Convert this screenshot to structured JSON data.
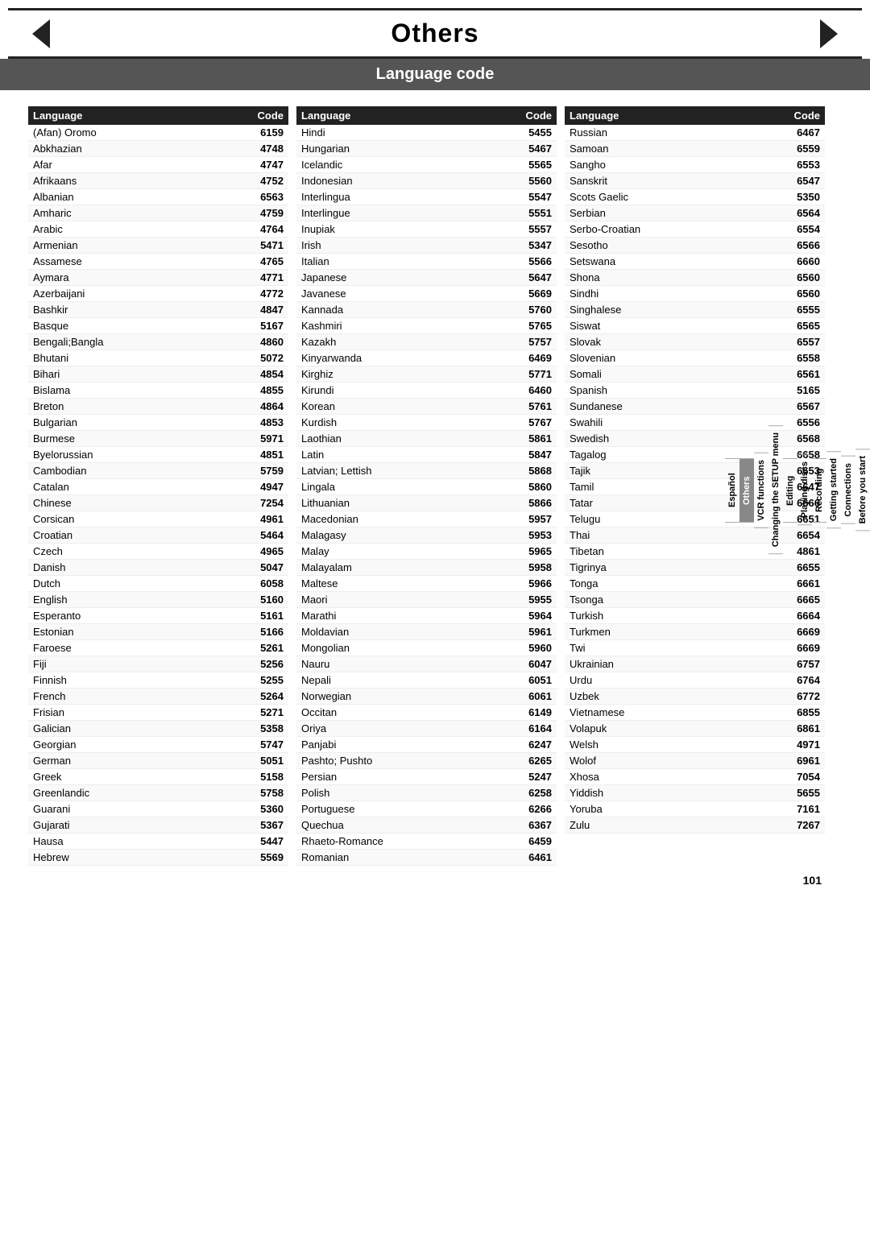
{
  "header": {
    "title": "Others",
    "subtitle": "Language code"
  },
  "columns": [
    {
      "header_lang": "Language",
      "header_code": "Code",
      "rows": [
        {
          "lang": "(Afan) Oromo",
          "code": "6159"
        },
        {
          "lang": "Abkhazian",
          "code": "4748"
        },
        {
          "lang": "Afar",
          "code": "4747"
        },
        {
          "lang": "Afrikaans",
          "code": "4752"
        },
        {
          "lang": "Albanian",
          "code": "6563"
        },
        {
          "lang": "Amharic",
          "code": "4759"
        },
        {
          "lang": "Arabic",
          "code": "4764"
        },
        {
          "lang": "Armenian",
          "code": "5471"
        },
        {
          "lang": "Assamese",
          "code": "4765"
        },
        {
          "lang": "Aymara",
          "code": "4771"
        },
        {
          "lang": "Azerbaijani",
          "code": "4772"
        },
        {
          "lang": "Bashkir",
          "code": "4847"
        },
        {
          "lang": "Basque",
          "code": "5167"
        },
        {
          "lang": "Bengali;Bangla",
          "code": "4860"
        },
        {
          "lang": "Bhutani",
          "code": "5072"
        },
        {
          "lang": "Bihari",
          "code": "4854"
        },
        {
          "lang": "Bislama",
          "code": "4855"
        },
        {
          "lang": "Breton",
          "code": "4864"
        },
        {
          "lang": "Bulgarian",
          "code": "4853"
        },
        {
          "lang": "Burmese",
          "code": "5971"
        },
        {
          "lang": "Byelorussian",
          "code": "4851"
        },
        {
          "lang": "Cambodian",
          "code": "5759"
        },
        {
          "lang": "Catalan",
          "code": "4947"
        },
        {
          "lang": "Chinese",
          "code": "7254"
        },
        {
          "lang": "Corsican",
          "code": "4961"
        },
        {
          "lang": "Croatian",
          "code": "5464"
        },
        {
          "lang": "Czech",
          "code": "4965"
        },
        {
          "lang": "Danish",
          "code": "5047"
        },
        {
          "lang": "Dutch",
          "code": "6058"
        },
        {
          "lang": "English",
          "code": "5160"
        },
        {
          "lang": "Esperanto",
          "code": "5161"
        },
        {
          "lang": "Estonian",
          "code": "5166"
        },
        {
          "lang": "Faroese",
          "code": "5261"
        },
        {
          "lang": "Fiji",
          "code": "5256"
        },
        {
          "lang": "Finnish",
          "code": "5255"
        },
        {
          "lang": "French",
          "code": "5264"
        },
        {
          "lang": "Frisian",
          "code": "5271"
        },
        {
          "lang": "Galician",
          "code": "5358"
        },
        {
          "lang": "Georgian",
          "code": "5747"
        },
        {
          "lang": "German",
          "code": "5051"
        },
        {
          "lang": "Greek",
          "code": "5158"
        },
        {
          "lang": "Greenlandic",
          "code": "5758"
        },
        {
          "lang": "Guarani",
          "code": "5360"
        },
        {
          "lang": "Gujarati",
          "code": "5367"
        },
        {
          "lang": "Hausa",
          "code": "5447"
        },
        {
          "lang": "Hebrew",
          "code": "5569"
        }
      ]
    },
    {
      "header_lang": "Language",
      "header_code": "Code",
      "rows": [
        {
          "lang": "Hindi",
          "code": "5455"
        },
        {
          "lang": "Hungarian",
          "code": "5467"
        },
        {
          "lang": "Icelandic",
          "code": "5565"
        },
        {
          "lang": "Indonesian",
          "code": "5560"
        },
        {
          "lang": "Interlingua",
          "code": "5547"
        },
        {
          "lang": "Interlingue",
          "code": "5551"
        },
        {
          "lang": "Inupiak",
          "code": "5557"
        },
        {
          "lang": "Irish",
          "code": "5347"
        },
        {
          "lang": "Italian",
          "code": "5566"
        },
        {
          "lang": "Japanese",
          "code": "5647"
        },
        {
          "lang": "Javanese",
          "code": "5669"
        },
        {
          "lang": "Kannada",
          "code": "5760"
        },
        {
          "lang": "Kashmiri",
          "code": "5765"
        },
        {
          "lang": "Kazakh",
          "code": "5757"
        },
        {
          "lang": "Kinyarwanda",
          "code": "6469"
        },
        {
          "lang": "Kirghiz",
          "code": "5771"
        },
        {
          "lang": "Kirundi",
          "code": "6460"
        },
        {
          "lang": "Korean",
          "code": "5761"
        },
        {
          "lang": "Kurdish",
          "code": "5767"
        },
        {
          "lang": "Laothian",
          "code": "5861"
        },
        {
          "lang": "Latin",
          "code": "5847"
        },
        {
          "lang": "Latvian; Lettish",
          "code": "5868"
        },
        {
          "lang": "Lingala",
          "code": "5860"
        },
        {
          "lang": "Lithuanian",
          "code": "5866"
        },
        {
          "lang": "Macedonian",
          "code": "5957"
        },
        {
          "lang": "Malagasy",
          "code": "5953"
        },
        {
          "lang": "Malay",
          "code": "5965"
        },
        {
          "lang": "Malayalam",
          "code": "5958"
        },
        {
          "lang": "Maltese",
          "code": "5966"
        },
        {
          "lang": "Maori",
          "code": "5955"
        },
        {
          "lang": "Marathi",
          "code": "5964"
        },
        {
          "lang": "Moldavian",
          "code": "5961"
        },
        {
          "lang": "Mongolian",
          "code": "5960"
        },
        {
          "lang": "Nauru",
          "code": "6047"
        },
        {
          "lang": "Nepali",
          "code": "6051"
        },
        {
          "lang": "Norwegian",
          "code": "6061"
        },
        {
          "lang": "Occitan",
          "code": "6149"
        },
        {
          "lang": "Oriya",
          "code": "6164"
        },
        {
          "lang": "Panjabi",
          "code": "6247"
        },
        {
          "lang": "Pashto; Pushto",
          "code": "6265"
        },
        {
          "lang": "Persian",
          "code": "5247"
        },
        {
          "lang": "Polish",
          "code": "6258"
        },
        {
          "lang": "Portuguese",
          "code": "6266"
        },
        {
          "lang": "Quechua",
          "code": "6367"
        },
        {
          "lang": "Rhaeto-Romance",
          "code": "6459"
        },
        {
          "lang": "Romanian",
          "code": "6461"
        }
      ]
    },
    {
      "header_lang": "Language",
      "header_code": "Code",
      "rows": [
        {
          "lang": "Russian",
          "code": "6467"
        },
        {
          "lang": "Samoan",
          "code": "6559"
        },
        {
          "lang": "Sangho",
          "code": "6553"
        },
        {
          "lang": "Sanskrit",
          "code": "6547"
        },
        {
          "lang": "Scots Gaelic",
          "code": "5350"
        },
        {
          "lang": "Serbian",
          "code": "6564"
        },
        {
          "lang": "Serbo-Croatian",
          "code": "6554"
        },
        {
          "lang": "Sesotho",
          "code": "6566"
        },
        {
          "lang": "Setswana",
          "code": "6660"
        },
        {
          "lang": "Shona",
          "code": "6560"
        },
        {
          "lang": "Sindhi",
          "code": "6560"
        },
        {
          "lang": "Singhalese",
          "code": "6555"
        },
        {
          "lang": "Siswat",
          "code": "6565"
        },
        {
          "lang": "Slovak",
          "code": "6557"
        },
        {
          "lang": "Slovenian",
          "code": "6558"
        },
        {
          "lang": "Somali",
          "code": "6561"
        },
        {
          "lang": "Spanish",
          "code": "5165"
        },
        {
          "lang": "Sundanese",
          "code": "6567"
        },
        {
          "lang": "Swahili",
          "code": "6556"
        },
        {
          "lang": "Swedish",
          "code": "6568"
        },
        {
          "lang": "Tagalog",
          "code": "6658"
        },
        {
          "lang": "Tajik",
          "code": "6653"
        },
        {
          "lang": "Tamil",
          "code": "6647"
        },
        {
          "lang": "Tatar",
          "code": "6666"
        },
        {
          "lang": "Telugu",
          "code": "6651"
        },
        {
          "lang": "Thai",
          "code": "6654"
        },
        {
          "lang": "Tibetan",
          "code": "4861"
        },
        {
          "lang": "Tigrinya",
          "code": "6655"
        },
        {
          "lang": "Tonga",
          "code": "6661"
        },
        {
          "lang": "Tsonga",
          "code": "6665"
        },
        {
          "lang": "Turkish",
          "code": "6664"
        },
        {
          "lang": "Turkmen",
          "code": "6669"
        },
        {
          "lang": "Twi",
          "code": "6669"
        },
        {
          "lang": "Ukrainian",
          "code": "6757"
        },
        {
          "lang": "Urdu",
          "code": "6764"
        },
        {
          "lang": "Uzbek",
          "code": "6772"
        },
        {
          "lang": "Vietnamese",
          "code": "6855"
        },
        {
          "lang": "Volapuk",
          "code": "6861"
        },
        {
          "lang": "Welsh",
          "code": "4971"
        },
        {
          "lang": "Wolof",
          "code": "6961"
        },
        {
          "lang": "Xhosa",
          "code": "7054"
        },
        {
          "lang": "Yiddish",
          "code": "5655"
        },
        {
          "lang": "Yoruba",
          "code": "7161"
        },
        {
          "lang": "Zulu",
          "code": "7267"
        }
      ]
    }
  ],
  "sidebar": {
    "sections": [
      {
        "label": "Before you start",
        "highlight": false
      },
      {
        "label": "Connections",
        "highlight": false
      },
      {
        "label": "Getting started",
        "highlight": false
      },
      {
        "label": "Recording",
        "highlight": false
      },
      {
        "label": "Playing discs",
        "highlight": false
      },
      {
        "label": "Editing",
        "highlight": false
      },
      {
        "label": "Changing the SETUP menu",
        "highlight": false
      },
      {
        "label": "VCR functions",
        "highlight": false
      },
      {
        "label": "Others",
        "highlight": true
      },
      {
        "label": "Español",
        "highlight": false
      }
    ]
  },
  "page_number": "101"
}
